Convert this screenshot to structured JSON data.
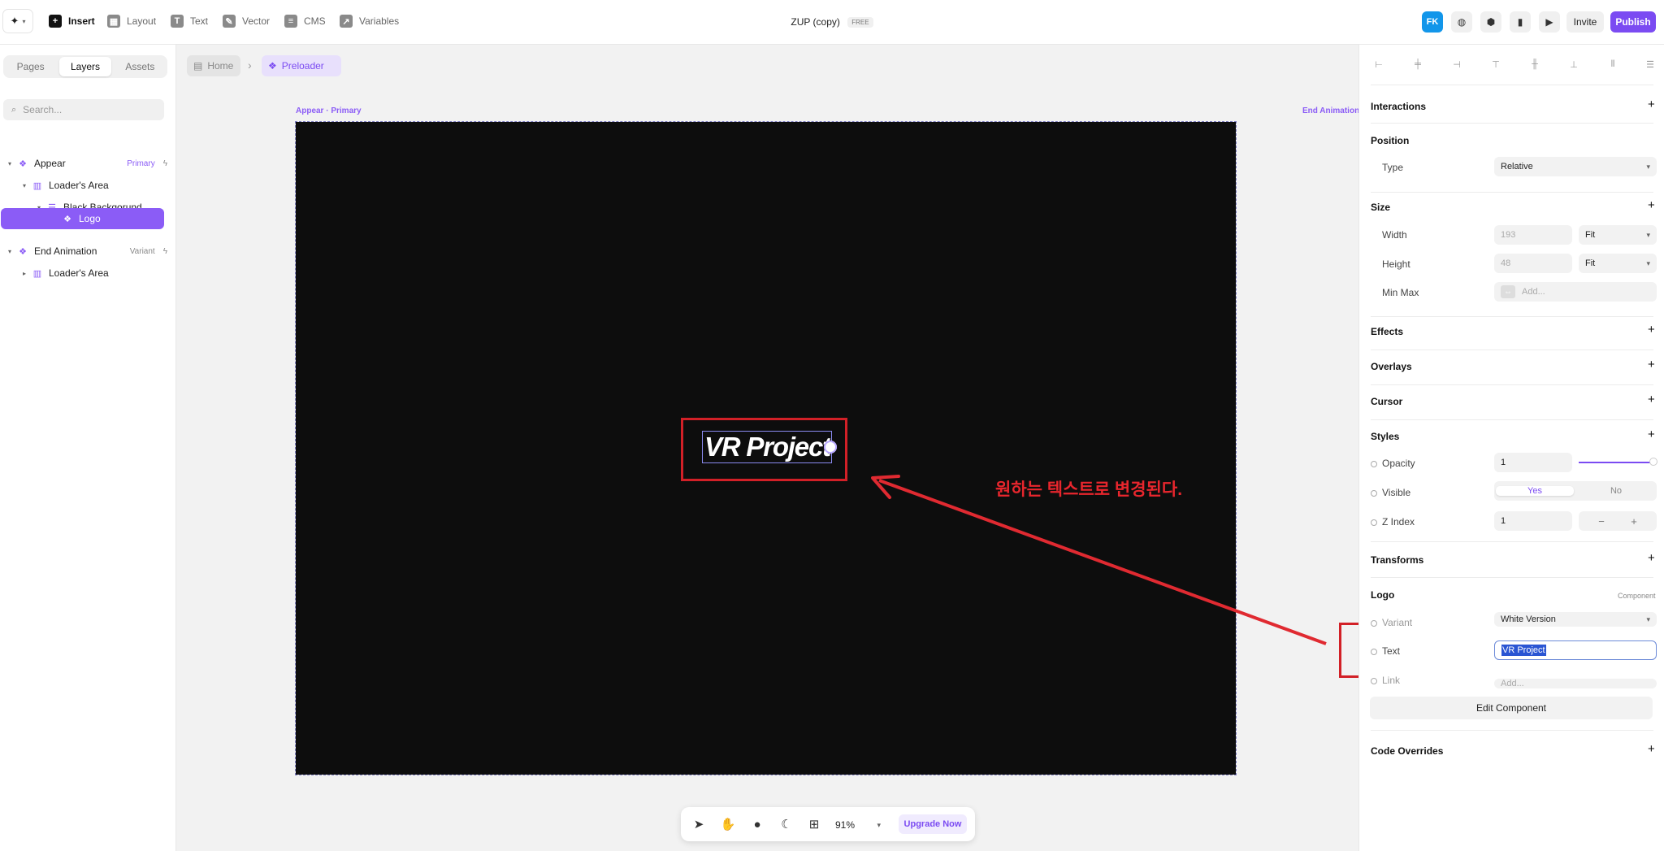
{
  "topbar": {
    "tools": [
      {
        "label": "Insert",
        "icon": "plus-icon",
        "glyph": "+",
        "active": true
      },
      {
        "label": "Layout",
        "icon": "layout-icon",
        "glyph": "▦",
        "active": false
      },
      {
        "label": "Text",
        "icon": "text-icon",
        "glyph": "T",
        "active": false
      },
      {
        "label": "Vector",
        "icon": "vector-icon",
        "glyph": "✎",
        "active": false
      },
      {
        "label": "CMS",
        "icon": "cms-icon",
        "glyph": "≡",
        "active": false
      },
      {
        "label": "Variables",
        "icon": "variables-icon",
        "glyph": "↗",
        "active": false
      }
    ],
    "project_title": "ZUP (copy)",
    "plan_badge": "FREE",
    "avatar_initials": "FK",
    "invite_label": "Invite",
    "publish_label": "Publish"
  },
  "left_panel": {
    "tabs": [
      "Pages",
      "Layers",
      "Assets"
    ],
    "active_tab": "Layers",
    "search_placeholder": "Search...",
    "layers": [
      {
        "label": "Appear",
        "tag": "Primary",
        "depth": 0,
        "icon": "component-icon"
      },
      {
        "label": "Loader's Area",
        "tag": "",
        "depth": 1,
        "icon": "stack-icon"
      },
      {
        "label": "Black Backgorund",
        "tag": "",
        "depth": 2,
        "icon": "frame-icon"
      },
      {
        "label": "Logo",
        "tag": "",
        "depth": 3,
        "icon": "component-icon",
        "selected": true
      },
      {
        "label": "End Animation",
        "tag": "Variant",
        "depth": 0,
        "icon": "component-icon"
      },
      {
        "label": "Loader's Area",
        "tag": "",
        "depth": 1,
        "icon": "stack-icon"
      }
    ]
  },
  "canvas": {
    "breadcrumbs": [
      "Home",
      "Preloader"
    ],
    "frame_label_left": "Appear · Primary",
    "frame_label_right": "End Animation",
    "logo_text": "VR Project",
    "annotation": "원하는 텍스트로 변경된다."
  },
  "bottom_toolbar": {
    "zoom": "91%",
    "upgrade_label": "Upgrade Now"
  },
  "right_panel": {
    "interactions": "Interactions",
    "position": {
      "title": "Position",
      "type_label": "Type",
      "type_value": "Relative"
    },
    "size": {
      "title": "Size",
      "width_label": "Width",
      "width_value": "193",
      "width_mode": "Fit",
      "height_label": "Height",
      "height_value": "48",
      "height_mode": "Fit",
      "minmax_label": "Min Max",
      "minmax_placeholder": "Add..."
    },
    "effects": "Effects",
    "overlays": "Overlays",
    "cursor": "Cursor",
    "styles": {
      "title": "Styles",
      "opacity_label": "Opacity",
      "opacity_value": "1",
      "visible_label": "Visible",
      "visible_yes": "Yes",
      "visible_no": "No",
      "zindex_label": "Z Index",
      "zindex_value": "1"
    },
    "transforms": "Transforms",
    "logo": {
      "title": "Logo",
      "tag": "Component",
      "variant_label": "Variant",
      "variant_value": "White Version",
      "text_label": "Text",
      "text_value": "VR Project",
      "link_label": "Link",
      "link_placeholder": "Add...",
      "edit_button": "Edit Component"
    },
    "code_overrides": "Code Overrides"
  },
  "colors": {
    "accent": "#8b5cf6",
    "publish": "#7b4bf2",
    "annotation_red": "#d22027",
    "canvas_bg": "#0d0d0d"
  }
}
